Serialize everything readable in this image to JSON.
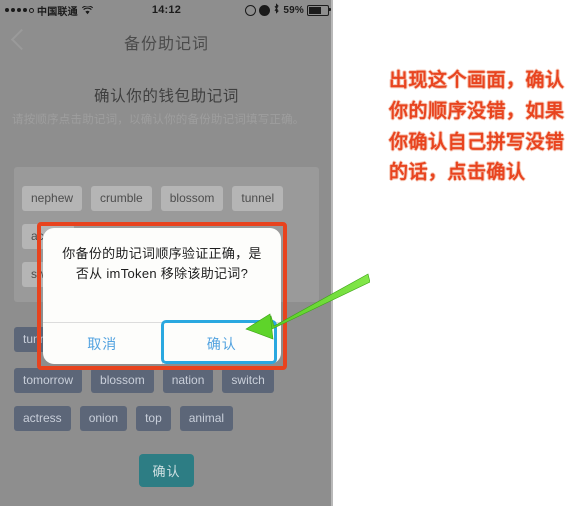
{
  "statusbar": {
    "carrier": "中国联通",
    "time": "14:12",
    "battery_pct": "59%",
    "signal_icon": "signal-dots-icon",
    "wifi_icon": "wifi-icon",
    "alarm_icon": "alarm-icon",
    "rotation_lock_icon": "rotation-lock-icon",
    "bluetooth_icon": "bluetooth-icon",
    "battery_icon": "battery-icon"
  },
  "navbar": {
    "title": "备份助记词",
    "back_icon": "back-chevron-icon"
  },
  "page": {
    "heading": "确认你的钱包助记词",
    "subtitle": "请按顺序点击助记词，以确认你的备份助记词填写正确。"
  },
  "wordbank": {
    "rows": [
      [
        "nephew",
        "crumble",
        "blossom",
        "tunnel"
      ],
      [
        "actress",
        "",
        "",
        ""
      ],
      [
        "switch",
        "",
        "",
        ""
      ]
    ],
    "row1": [
      "nephew",
      "crumble",
      "blossom",
      "tunnel"
    ],
    "partial_left": [
      "ac",
      "sw"
    ]
  },
  "selected": {
    "row0": [
      "tunnel"
    ],
    "row1": [
      "tomorrow",
      "blossom",
      "nation",
      "switch"
    ],
    "row2": [
      "actress",
      "onion",
      "top",
      "animal"
    ]
  },
  "bottom": {
    "confirm_label": "确认"
  },
  "modal": {
    "message": "你备份的助记词顺序验证正确，是否从 imToken 移除该助记词?",
    "cancel_label": "取消",
    "confirm_label": "确认"
  },
  "annotation": {
    "text": "出现这个画面，确认你的顺序没错，如果你确认自己拼写没错的话，点击确认",
    "arrow_icon": "green-arrow-icon",
    "arrow_color": "#5cd62a",
    "highlight_color": "#e8431e",
    "ok_highlight_color": "#2aa8e0"
  }
}
